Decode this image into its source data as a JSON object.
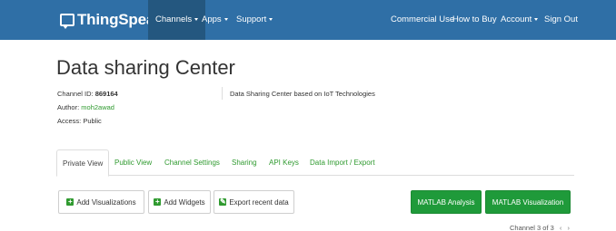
{
  "navbar": {
    "brand": "ThingSpeak",
    "brand_tm": "™",
    "left_items": [
      {
        "label": "Channels"
      },
      {
        "label": "Apps"
      },
      {
        "label": "Support"
      }
    ],
    "right_items": [
      {
        "label": "Commercial Use"
      },
      {
        "label": "How to Buy"
      },
      {
        "label": "Account"
      },
      {
        "label": "Sign Out"
      }
    ]
  },
  "page": {
    "title": "Data sharing Center"
  },
  "channel": {
    "id_label": "Channel ID:",
    "id_value": "869164",
    "author_label": "Author:",
    "author_value": "moh2awad",
    "access_label": "Access:",
    "access_value": "Public",
    "description": "Data Sharing Center based on IoT Technologies"
  },
  "tabs": [
    {
      "label": "Private View",
      "active": true
    },
    {
      "label": "Public View"
    },
    {
      "label": "Channel Settings"
    },
    {
      "label": "Sharing"
    },
    {
      "label": "API Keys"
    },
    {
      "label": "Data Import / Export"
    }
  ],
  "actions": {
    "add_visualizations": "Add Visualizations",
    "add_widgets": "Add Widgets",
    "export_recent_data": "Export recent data",
    "matlab_analysis": "MATLAB Analysis",
    "matlab_visualization": "MATLAB Visualization"
  },
  "pager": {
    "text": "Channel 3 of 3",
    "prev": "‹",
    "next": "›"
  },
  "colors": {
    "navbar": "#2f6fa6",
    "navbar_active": "#24577f",
    "link_green": "#2f9a2f",
    "button_green": "#1f9a3a"
  }
}
